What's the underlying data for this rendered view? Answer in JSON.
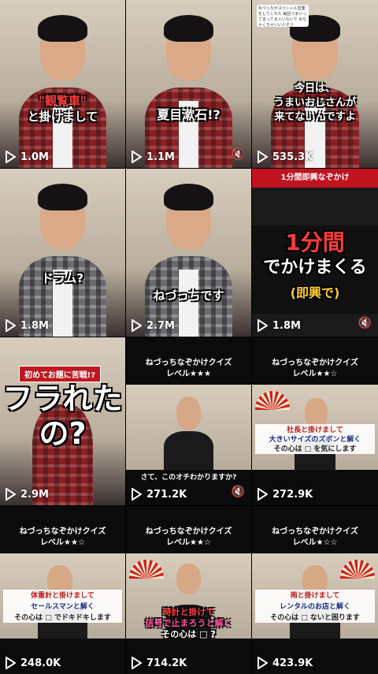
{
  "tiles": [
    {
      "caption_lines": [
        "\"観覧車\"",
        "と掛けまして"
      ],
      "views": "1.0M",
      "muted": false
    },
    {
      "caption_lines": [
        "夏目漱石!?"
      ],
      "views": "1.1M",
      "muted": true
    },
    {
      "caption_lines": [
        "今日は、",
        "うまいおじさんが",
        "来てないんですよ"
      ],
      "views": "535.3K",
      "muted": false,
      "small_card": "ねづっちがスペシャル営業をしてくれた 毎回うまいって言ってる人いないで めちゃくちゃいい人そう"
    },
    {
      "caption_lines": [
        "ドラム?"
      ],
      "views": "1.8M",
      "muted": false
    },
    {
      "caption_lines": [
        "ねづっちです"
      ],
      "views": "2.7M",
      "muted": false
    },
    {
      "topbar": "1分間即興なぞかけ",
      "caption_lines": [
        "1分間",
        "でかけまくる",
        "(即興で)"
      ],
      "views": "1.8M",
      "muted": true
    },
    {
      "badge": "初めてお題に苦戦!?",
      "caption_lines": [
        "フラれた",
        "の?"
      ],
      "views": "2.9M",
      "muted": false
    },
    {
      "quiz_title": "ねづっちなぞかけクイズ",
      "quiz_level": "レベル★★★",
      "quiz_lines": [
        "さて、このオチわかりますか?"
      ],
      "views": "271.2K",
      "muted": true
    },
    {
      "quiz_title": "ねづっちなぞかけクイズ",
      "quiz_level": "レベル★★☆",
      "quiz_lines": [
        "社長と掛けまして",
        "大きいサイズのズボンと解く",
        "その心は □ を気にします"
      ],
      "views": "272.9K",
      "muted": false
    },
    {
      "quiz_title": "ねづっちなぞかけクイズ",
      "quiz_level": "レベル★★☆",
      "quiz_lines": [
        "体重計と掛けまして",
        "セールスマンと解く",
        "その心は □ でドキドキします"
      ],
      "views": "248.0K",
      "muted": false
    },
    {
      "quiz_title": "ねづっちなぞかけクイズ",
      "quiz_level": "レベル★★☆",
      "quiz_lines": [
        "時計と掛けて",
        "信号で止まろうと解く",
        "その心は □ ?"
      ],
      "views": "714.2K",
      "muted": false
    },
    {
      "quiz_title": "ねづっちなぞかけクイズ",
      "quiz_level": "レベル★☆☆",
      "quiz_lines": [
        "雨と掛けまして",
        "レンタルのお店と解く",
        "その心は □ ないと困ります"
      ],
      "views": "423.9K",
      "muted": false
    }
  ],
  "icons": {
    "play": "play-outline-icon",
    "mute": "speaker-muted-icon"
  },
  "colors": {
    "background": "#000000",
    "jacket_red": "#8b1f22",
    "caption_red": "#ff3b3b",
    "banner_red": "#c1121f"
  }
}
